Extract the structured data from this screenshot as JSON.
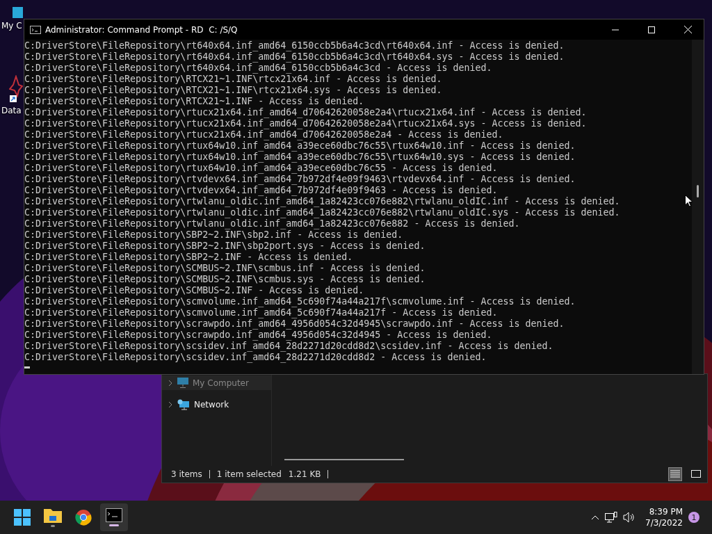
{
  "desktop_icons": [
    {
      "kind": "computer",
      "label": "My C"
    },
    {
      "kind": "app",
      "label": "Data"
    }
  ],
  "explorer": {
    "sidebar_items": [
      {
        "kind": "computer",
        "label": "My Computer"
      },
      {
        "kind": "network",
        "label": "Network"
      }
    ],
    "status_bar": {
      "items": "3 items",
      "selection": "1 item selected",
      "size": "1.21 KB"
    },
    "views": [
      {
        "kind": "details",
        "selected": true
      },
      {
        "kind": "tiles",
        "selected": false
      }
    ]
  },
  "console": {
    "title": "Administrator: Command Prompt - RD  C: /S/Q",
    "lines": [
      "C:DriverStore\\FileRepository\\rt640x64.inf_amd64_6150ccb5b6a4c3cd\\rt640x64.inf - Access is denied.",
      "C:DriverStore\\FileRepository\\rt640x64.inf_amd64_6150ccb5b6a4c3cd\\rt640x64.sys - Access is denied.",
      "C:DriverStore\\FileRepository\\rt640x64.inf_amd64_6150ccb5b6a4c3cd - Access is denied.",
      "C:DriverStore\\FileRepository\\RTCX21~1.INF\\rtcx21x64.inf - Access is denied.",
      "C:DriverStore\\FileRepository\\RTCX21~1.INF\\rtcx21x64.sys - Access is denied.",
      "C:DriverStore\\FileRepository\\RTCX21~1.INF - Access is denied.",
      "C:DriverStore\\FileRepository\\rtucx21x64.inf_amd64_d70642620058e2a4\\rtucx21x64.inf - Access is denied.",
      "C:DriverStore\\FileRepository\\rtucx21x64.inf_amd64_d70642620058e2a4\\rtucx21x64.sys - Access is denied.",
      "C:DriverStore\\FileRepository\\rtucx21x64.inf_amd64_d70642620058e2a4 - Access is denied.",
      "C:DriverStore\\FileRepository\\rtux64w10.inf_amd64_a39ece60dbc76c55\\rtux64w10.inf - Access is denied.",
      "C:DriverStore\\FileRepository\\rtux64w10.inf_amd64_a39ece60dbc76c55\\rtux64w10.sys - Access is denied.",
      "C:DriverStore\\FileRepository\\rtux64w10.inf_amd64_a39ece60dbc76c55 - Access is denied.",
      "C:DriverStore\\FileRepository\\rtvdevx64.inf_amd64_7b972df4e09f9463\\rtvdevx64.inf - Access is denied.",
      "C:DriverStore\\FileRepository\\rtvdevx64.inf_amd64_7b972df4e09f9463 - Access is denied.",
      "C:DriverStore\\FileRepository\\rtwlanu_oldic.inf_amd64_1a82423cc076e882\\rtwlanu_oldIC.inf - Access is denied.",
      "C:DriverStore\\FileRepository\\rtwlanu_oldic.inf_amd64_1a82423cc076e882\\rtwlanu_oldIC.sys - Access is denied.",
      "C:DriverStore\\FileRepository\\rtwlanu_oldic.inf_amd64_1a82423cc076e882 - Access is denied.",
      "C:DriverStore\\FileRepository\\SBP2~2.INF\\sbp2.inf - Access is denied.",
      "C:DriverStore\\FileRepository\\SBP2~2.INF\\sbp2port.sys - Access is denied.",
      "C:DriverStore\\FileRepository\\SBP2~2.INF - Access is denied.",
      "C:DriverStore\\FileRepository\\SCMBUS~2.INF\\scmbus.inf - Access is denied.",
      "C:DriverStore\\FileRepository\\SCMBUS~2.INF\\scmbus.sys - Access is denied.",
      "C:DriverStore\\FileRepository\\SCMBUS~2.INF - Access is denied.",
      "C:DriverStore\\FileRepository\\scmvolume.inf_amd64_5c690f74a44a217f\\scmvolume.inf - Access is denied.",
      "C:DriverStore\\FileRepository\\scmvolume.inf_amd64_5c690f74a44a217f - Access is denied.",
      "C:DriverStore\\FileRepository\\scrawpdo.inf_amd64_4956d054c32d4945\\scrawpdo.inf - Access is denied.",
      "C:DriverStore\\FileRepository\\scrawpdo.inf_amd64_4956d054c32d4945 - Access is denied.",
      "C:DriverStore\\FileRepository\\scsidev.inf_amd64_28d2271d20cdd8d2\\scsidev.inf - Access is denied.",
      "C:DriverStore\\FileRepository\\scsidev.inf_amd64_28d2271d20cdd8d2 - Access is denied."
    ]
  },
  "taskbar": {
    "apps": [
      {
        "kind": "start",
        "selected": false
      },
      {
        "kind": "explorer",
        "selected": false
      },
      {
        "kind": "chrome",
        "selected": false
      },
      {
        "kind": "terminal",
        "selected": true
      }
    ],
    "time": "8:39 PM",
    "date": "7/3/2022",
    "notifications": "1"
  }
}
